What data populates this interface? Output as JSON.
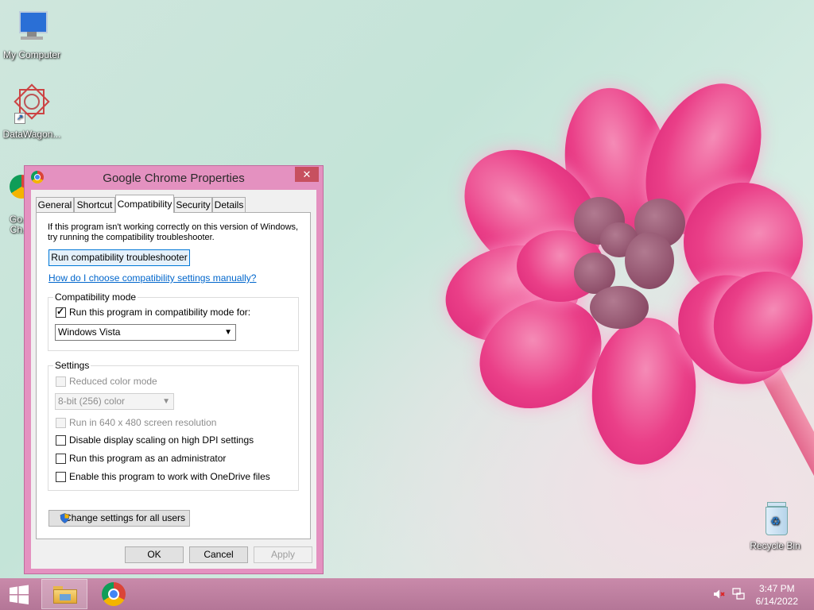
{
  "desktop": {
    "icons": [
      {
        "label": "My Computer"
      },
      {
        "label": "DataWagon..."
      },
      {
        "label": "Go…\nCh…"
      },
      {
        "label": "Recycle Bin"
      }
    ]
  },
  "dialog": {
    "title": "Google Chrome Properties",
    "close_glyph": "✕",
    "tabs": [
      {
        "label": "General"
      },
      {
        "label": "Shortcut"
      },
      {
        "label": "Compatibility",
        "active": true
      },
      {
        "label": "Security"
      },
      {
        "label": "Details"
      }
    ],
    "intro_line1": "If this program isn't working correctly on this version of Windows,",
    "intro_line2": "try running the compatibility troubleshooter.",
    "troubleshooter_button": "Run compatibility troubleshooter",
    "help_link": "How do I choose compatibility settings manually?",
    "compat_group": {
      "label": "Compatibility mode",
      "checkbox_label": "Run this program in compatibility mode for:",
      "checked": true,
      "selected_os": "Windows Vista"
    },
    "settings_group": {
      "label": "Settings",
      "reduced_color": {
        "label": "Reduced color mode",
        "checked": false,
        "disabled": true
      },
      "color_select": {
        "value": "8-bit (256) color",
        "disabled": true
      },
      "res_640": {
        "label": "Run in 640 x 480 screen resolution",
        "checked": false,
        "disabled": true
      },
      "dpi": {
        "label": "Disable display scaling on high DPI settings",
        "checked": false
      },
      "admin": {
        "label": "Run this program as an administrator",
        "checked": false
      },
      "onedrive": {
        "label": "Enable this program to work with OneDrive files",
        "checked": false
      }
    },
    "all_users_button": "Change settings for all users",
    "ok_button": "OK",
    "cancel_button": "Cancel",
    "apply_button": "Apply"
  },
  "taskbar": {
    "time": "3:47 PM",
    "date": "6/14/2022"
  },
  "colors": {
    "accent": "#0078d7",
    "link": "#0066cc",
    "dialog_frame": "#e491c0",
    "taskbar": "#b47697",
    "close_button": "#c7505f"
  }
}
